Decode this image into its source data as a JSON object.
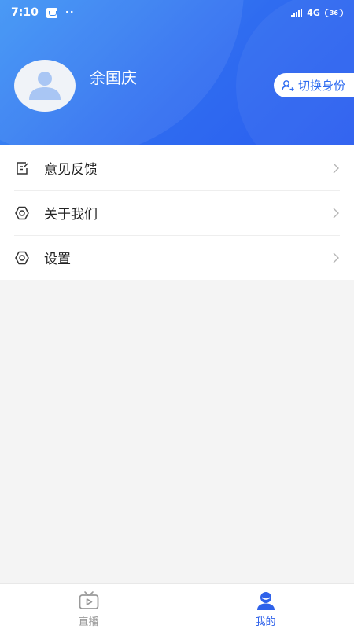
{
  "status_bar": {
    "time": "7:10",
    "dots": "··",
    "network": "4G",
    "battery": "36"
  },
  "profile": {
    "name": "余国庆",
    "switch_label": "切换身份"
  },
  "menu": {
    "items": [
      {
        "label": "意见反馈",
        "icon": "feedback-edit-icon"
      },
      {
        "label": "关于我们",
        "icon": "gear-icon"
      },
      {
        "label": "设置",
        "icon": "gear-icon"
      }
    ]
  },
  "tabbar": {
    "tabs": [
      {
        "label": "直播",
        "icon": "tv-play-icon",
        "active": false
      },
      {
        "label": "我的",
        "icon": "person-icon",
        "active": true
      }
    ]
  },
  "colors": {
    "accent": "#2f6cf0",
    "header_gradient_start": "#3d93f5",
    "header_gradient_end": "#2a5cf0",
    "active_tab": "#2f62ea",
    "inactive_tab": "#9a9a9a",
    "background": "#f4f4f4"
  }
}
